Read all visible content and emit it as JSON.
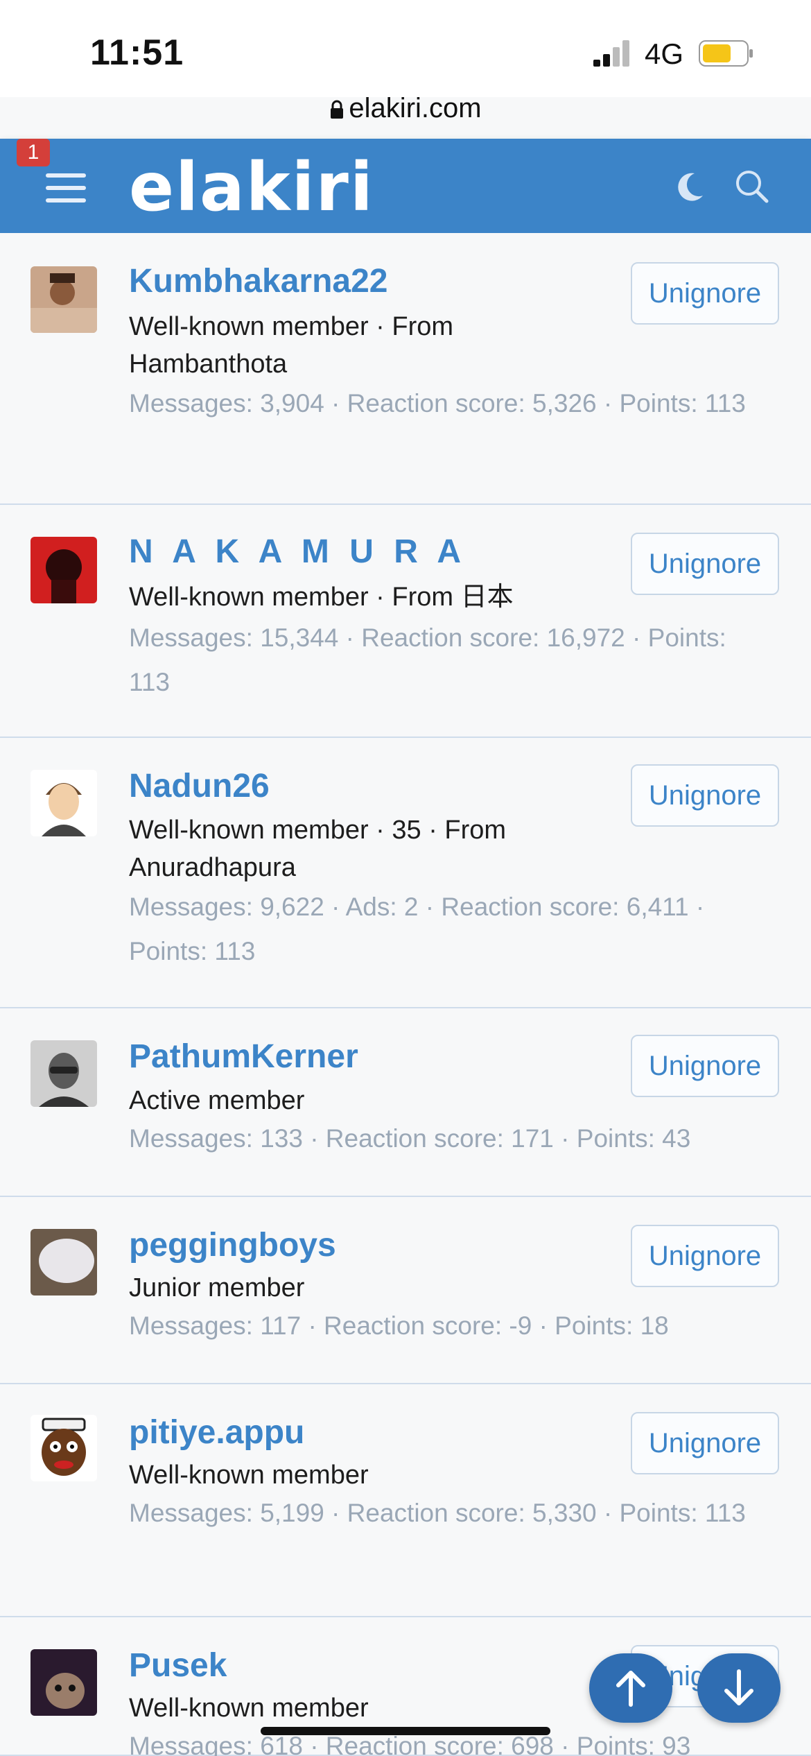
{
  "status_bar": {
    "time": "11:51",
    "network": "4G"
  },
  "browser": {
    "url": "elakiri.com"
  },
  "header": {
    "logo": "elakiri",
    "notification_count": "1"
  },
  "members": [
    {
      "name": "Kumbhakarna22",
      "info": "Well-known member · From Hambanthota",
      "stats": "Messages: 3,904 · Reaction score: 5,326 · Points: 113",
      "action": "Unignore"
    },
    {
      "name": "N A K A M U R A",
      "info": "Well-known member · From 日本",
      "stats": "Messages: 15,344 · Reaction score: 16,972 · Points: 113",
      "action": "Unignore"
    },
    {
      "name": "Nadun26",
      "info": "Well-known member · 35 · From Anuradhapura",
      "stats": "Messages: 9,622 · Ads: 2 · Reaction score: 6,411 · Points: 113",
      "action": "Unignore"
    },
    {
      "name": "PathumKerner",
      "info": "Active member",
      "stats": "Messages: 133 · Reaction score: 171 · Points: 43",
      "action": "Unignore"
    },
    {
      "name": "peggingboys",
      "info": "Junior member",
      "stats": "Messages: 117 · Reaction score: -9 · Points: 18",
      "action": "Unignore"
    },
    {
      "name": "pitiye.appu",
      "info": "Well-known member",
      "stats": "Messages: 5,199 · Reaction score: 5,330 · Points: 113",
      "action": "Unignore"
    },
    {
      "name": "Pusek",
      "info": "Well-known member",
      "stats": "Messages: 618 · Reaction score: 698 · Points: 93",
      "action": "Unignore"
    }
  ],
  "colors": {
    "accent": "#3c84c8",
    "header_bg": "#3c84c8",
    "badge": "#d43f3a",
    "muted": "#9aa7b6"
  }
}
